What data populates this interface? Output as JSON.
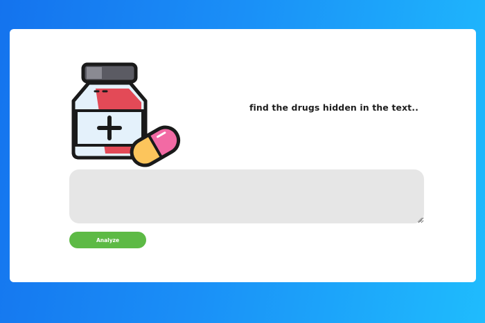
{
  "header": {
    "tagline": "find the drugs hidden in the text.."
  },
  "hero": {
    "icon": "medicine-bottle-and-capsule-icon"
  },
  "input": {
    "value": "",
    "placeholder": ""
  },
  "actions": {
    "analyze_label": "Analyze"
  },
  "colors": {
    "background_start": "#1473ee",
    "background_end": "#1fbcfd",
    "card": "#ffffff",
    "input_background": "#e6e6e6",
    "analyze_button": "#5dba45",
    "bottle_label": "#e34a57",
    "bottle_body": "#e4f1fb",
    "capsule_pink": "#f26aa4",
    "capsule_yellow": "#fcc55c"
  }
}
